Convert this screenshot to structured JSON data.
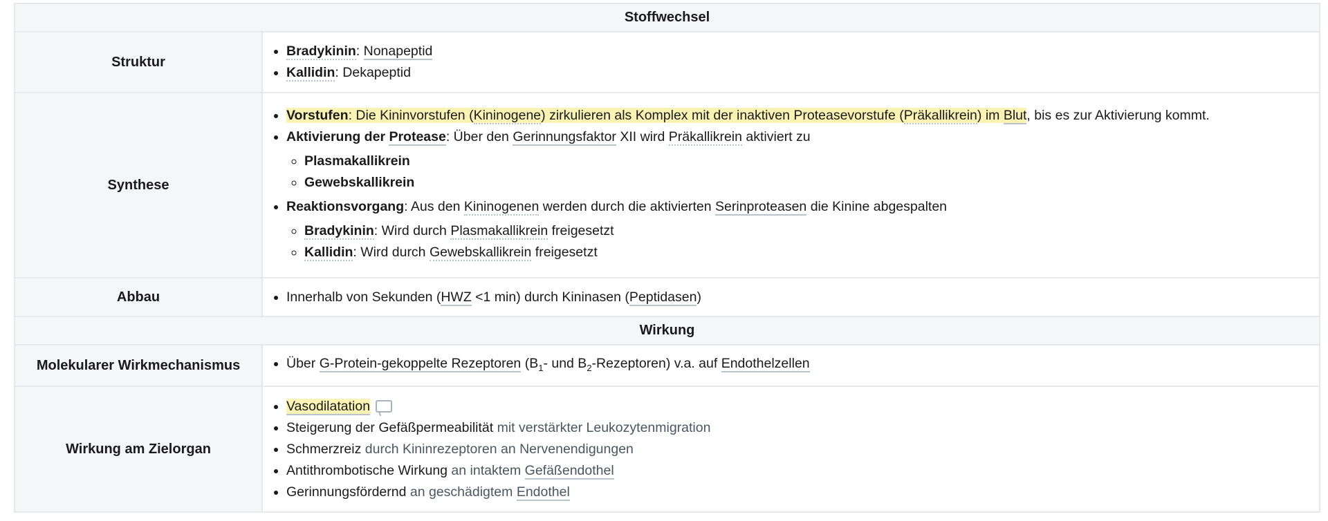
{
  "sections": {
    "stoffwechsel": "Stoffwechsel",
    "wirkung": "Wirkung"
  },
  "struktur": {
    "label": "Struktur",
    "items": [
      {
        "term": "Bradykinin",
        "sep": ": ",
        "text": "Nonapeptid"
      },
      {
        "term": "Kallidin",
        "sep": ": ",
        "text": "Dekapeptid"
      }
    ]
  },
  "synthese": {
    "label": "Synthese",
    "vorstufen": {
      "term": "Vorstufen",
      "t1": ": Die Kininvorstufen (",
      "l1": "Kininogene",
      "t2": ") zirkulieren als Komplex mit der inaktiven Proteasevorstufe (",
      "l2": "Präkallikrein",
      "t3": ") im ",
      "l3": "Blut",
      "t4": ", bis es zur Aktivierung kommt."
    },
    "aktivierung": {
      "t0": "Aktivierung der ",
      "term": "Protease",
      "t1": ": Über den ",
      "l1": "Gerinnungsfaktor",
      "t2": " XII wird ",
      "l2": "Präkallikrein",
      "t3": " aktiviert zu",
      "sub": [
        "Plasmakallikrein",
        "Gewebskallikrein"
      ]
    },
    "reaktion": {
      "term": "Reaktionsvorgang",
      "t1": ": Aus den ",
      "l1": "Kininogenen",
      "t2": " werden durch die aktivierten ",
      "l2": "Serinproteasen",
      "t3": " die Kinine abgespalten",
      "sub": [
        {
          "term": "Bradykinin",
          "t1": ": Wird durch ",
          "l1": "Plasmakallikrein",
          "t2": " freigesetzt"
        },
        {
          "term": "Kallidin",
          "t1": ": Wird durch ",
          "l1": "Gewebskallikrein",
          "t2": " freigesetzt"
        }
      ]
    }
  },
  "abbau": {
    "label": "Abbau",
    "t1": "Innerhalb von Sekunden (",
    "l1": "HWZ",
    "t2": " <1 min) durch Kininasen (",
    "l2": "Peptidasen",
    "t3": ")"
  },
  "molekular": {
    "label": "Molekularer Wirkmechanismus",
    "t1": "Über ",
    "l1": "G-Protein-gekoppelte Rezeptoren",
    "t2": " (B",
    "s1": "1",
    "t3": "- und B",
    "s2": "2",
    "t4": "-Rezeptoren) v.a. auf ",
    "l2": "Endothelzellen"
  },
  "ziel": {
    "label": "Wirkung am Zielorgan",
    "items": [
      {
        "main": "Vasodilatation"
      },
      {
        "main": "Steigerung der Gefäßpermeabilität",
        "muted": " mit verstärkter Leukozytenmigration"
      },
      {
        "main": "Schmerzreiz",
        "muted": " durch Kininrezeptoren an Nervenendigungen"
      },
      {
        "main": "Antithrombotische Wirkung",
        "muted": " an intaktem ",
        "link": "Gefäßendothel"
      },
      {
        "main": "Gerinnungsfördernd",
        "muted": " an geschädigtem ",
        "link": "Endothel"
      }
    ]
  }
}
